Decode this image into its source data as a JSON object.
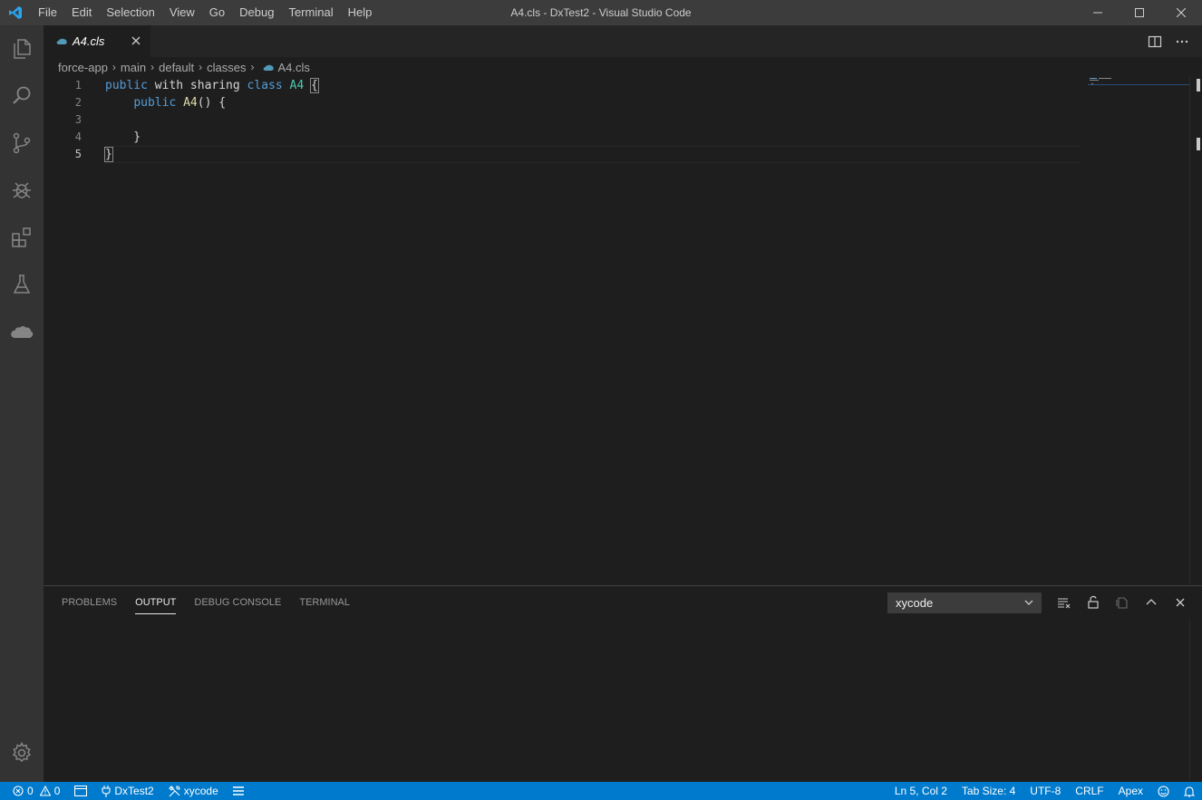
{
  "window": {
    "title": "A4.cls - DxTest2 - Visual Studio Code",
    "menu": [
      "File",
      "Edit",
      "Selection",
      "View",
      "Go",
      "Debug",
      "Terminal",
      "Help"
    ]
  },
  "activity_bar": {
    "icons": [
      "explorer-icon",
      "search-icon",
      "source-control-icon",
      "debug-icon",
      "extensions-icon",
      "test-flask-icon",
      "salesforce-cloud-icon"
    ],
    "settings_icon": "gear-icon"
  },
  "editor": {
    "tab": {
      "label": "A4.cls",
      "icon": "apex-file-icon"
    },
    "breadcrumbs": [
      "force-app",
      "main",
      "default",
      "classes",
      "A4.cls"
    ],
    "line_numbers": [
      "1",
      "2",
      "3",
      "4",
      "5"
    ],
    "code": {
      "l1_public": "public",
      "l1_with": " with sharing ",
      "l1_class": "class",
      "l1_space": " ",
      "l1_name": "A4",
      "l1_open": "{",
      "l2_indent": "    ",
      "l2_public": "public",
      "l2_ctor": "A4",
      "l2_rest": "() {",
      "l4": "    }",
      "l5": "}"
    }
  },
  "panel": {
    "tabs": [
      "PROBLEMS",
      "OUTPUT",
      "DEBUG CONSOLE",
      "TERMINAL"
    ],
    "active_tab": "OUTPUT",
    "output_channel": "xycode"
  },
  "status_bar": {
    "errors": "0",
    "warnings": "0",
    "org": "DxTest2",
    "tool": "xycode",
    "cursor": "Ln 5, Col 2",
    "tab_size": "Tab Size: 4",
    "encoding": "UTF-8",
    "eol": "CRLF",
    "language": "Apex"
  },
  "colors": {
    "accent": "#007acc",
    "keyword": "#569cd6",
    "type": "#4ec9b0",
    "function": "#dcdcaa"
  }
}
